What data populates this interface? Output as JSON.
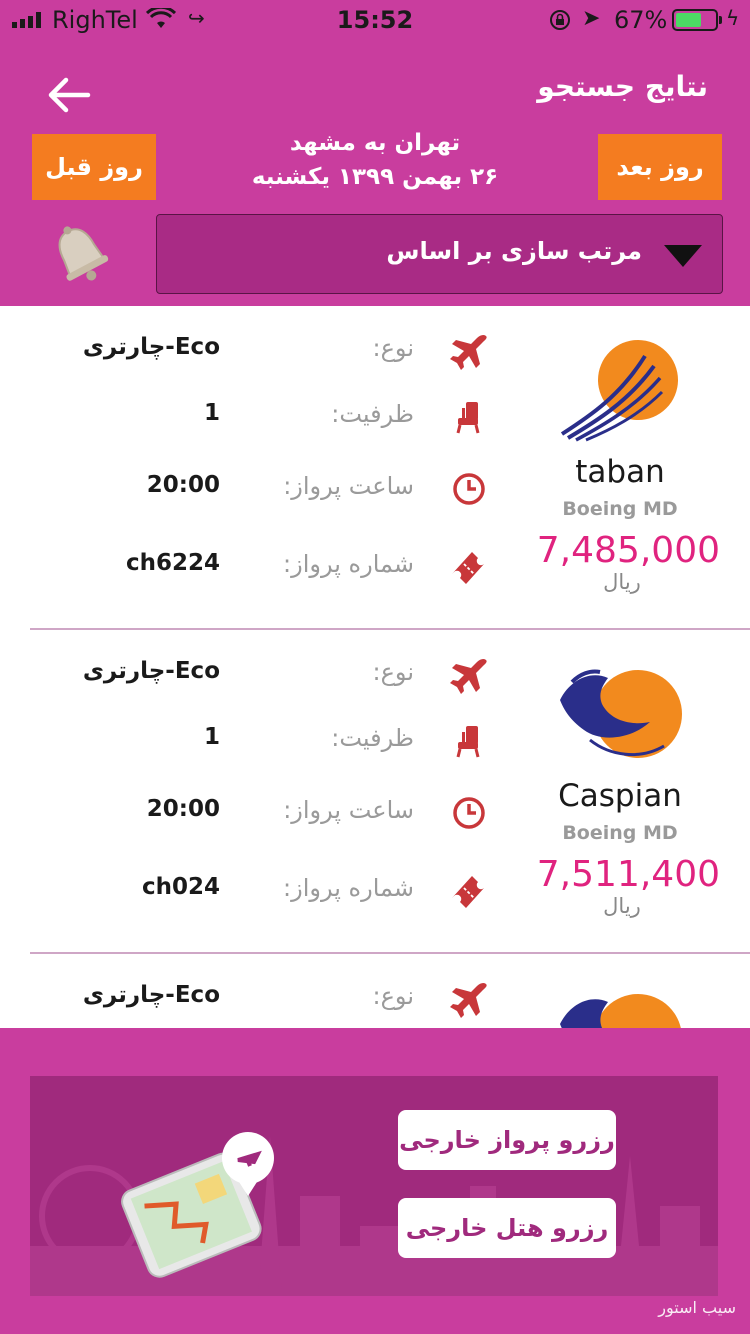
{
  "status_bar": {
    "carrier": "RighTel",
    "time": "15:52",
    "battery_percent": "67%",
    "battery_level": 0.67,
    "icons": [
      "signal-icon",
      "wifi-icon",
      "rotation-lock-icon",
      "location-icon",
      "battery-icon",
      "charging-icon"
    ]
  },
  "header": {
    "title": "نتایج جستجو",
    "back_icon": "back-arrow-icon",
    "prev_day_label": "روز قبل",
    "next_day_label": "روز بعد",
    "route": "تهران به مشهد",
    "date": "۲۶ بهمن ۱۳۹۹ یکشنبه",
    "sort_label": "مرتب سازی بر اساس",
    "colors": {
      "primary": "#c93d9e",
      "accent": "#f47c20",
      "sort_bg": "#a92b85"
    }
  },
  "flights": [
    {
      "airline": "taban",
      "aircraft": "Boeing MD",
      "price": "7,485,000",
      "currency": "ریال",
      "type_label": "نوع:",
      "type_value": "چارتری-Eco",
      "capacity_label": "ظرفیت:",
      "capacity_value": "1",
      "time_label": "ساعت پرواز:",
      "time_value": "20:00",
      "number_label": "شماره پرواز:",
      "number_value": "ch6224"
    },
    {
      "airline": "Caspian",
      "aircraft": "Boeing MD",
      "price": "7,511,400",
      "currency": "ریال",
      "type_label": "نوع:",
      "type_value": "چارتری-Eco",
      "capacity_label": "ظرفیت:",
      "capacity_value": "1",
      "time_label": "ساعت پرواز:",
      "time_value": "20:00",
      "number_label": "شماره پرواز:",
      "number_value": "ch024"
    },
    {
      "type_label": "نوع:",
      "type_value": "چارتری-Eco"
    }
  ],
  "banner": {
    "flight_button": "رزرو پرواز خارجی",
    "hotel_button": "رزرو هتل خارجی",
    "watermark": "سیب استور"
  }
}
